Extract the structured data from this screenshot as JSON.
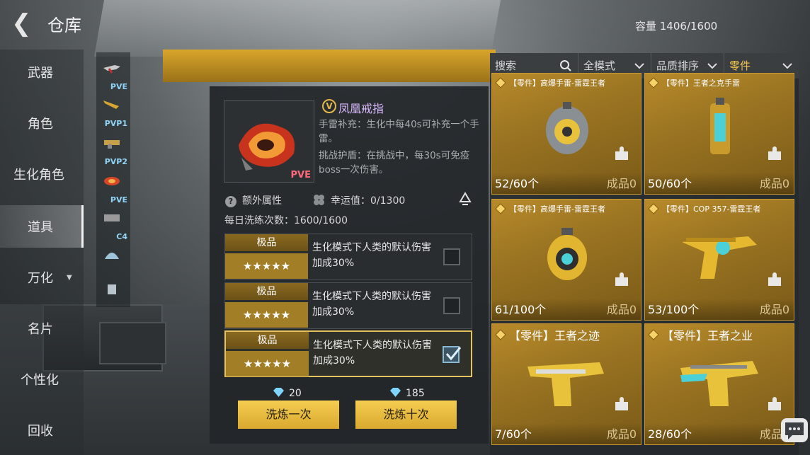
{
  "header": {
    "title": "仓库",
    "capacity": "容量 1406/1600"
  },
  "sidebar": {
    "items": [
      {
        "label": "武器"
      },
      {
        "label": "角色"
      },
      {
        "label": "生化角色"
      },
      {
        "label": "道具"
      },
      {
        "label": "万化"
      },
      {
        "label": "名片"
      },
      {
        "label": "个性化"
      },
      {
        "label": "回收"
      }
    ],
    "active": "道具"
  },
  "categories": [
    {
      "tag": "PVE"
    },
    {
      "tag": "PVP1"
    },
    {
      "tag": "PVP2"
    },
    {
      "tag": "PVE"
    },
    {
      "tag": "C4"
    },
    {
      "tag": ""
    },
    {
      "tag": ""
    }
  ],
  "detail": {
    "badge": "V",
    "name": "凤凰戒指",
    "thumb_tag": "PVE",
    "desc1": "手雷补充：生化中每40s可补充一个手雷。",
    "desc2": "挑战护盾：在挑战中，每30s可免疫boss一次伤害。",
    "extra_label": "额外属性",
    "luck": "幸运值：0/1300",
    "daily": "每日洗练次数：1600/1600",
    "attributes": [
      {
        "grade": "极品",
        "stars": "★★★★★",
        "text": "生化模式下人类的默认伤害加成30%",
        "checked": false
      },
      {
        "grade": "极品",
        "stars": "★★★★★",
        "text": "生化模式下人类的默认伤害加成30%",
        "checked": false
      },
      {
        "grade": "极品",
        "stars": "★★★★★",
        "text": "生化模式下人类的默认伤害加成30%",
        "checked": true
      }
    ],
    "cost_once": "20",
    "cost_ten": "185",
    "btn_once": "洗炼一次",
    "btn_ten": "洗炼十次"
  },
  "filters": {
    "search_placeholder": "搜索",
    "mode": "全模式",
    "sort": "品质排序",
    "type": "零件"
  },
  "cards": [
    {
      "title": "【零件】高爆手雷-雷霆王者",
      "count": "52/60个",
      "made": "成品0"
    },
    {
      "title": "【零件】王者之克手雷",
      "count": "50/60个",
      "made": "成品0"
    },
    {
      "title": "【零件】高爆手雷-雷霆王者",
      "count": "61/100个",
      "made": "成品0"
    },
    {
      "title": "【零件】COP 357-雷霆王者",
      "count": "53/100个",
      "made": "成品0"
    },
    {
      "title": "【零件】王者之迹",
      "count": "7/60个",
      "made": "成品0"
    },
    {
      "title": "【零件】王者之业",
      "count": "28/60个",
      "made": "成品0"
    }
  ],
  "colors": {
    "accent": "#f0c24c",
    "card": "#9a7422",
    "button": "#e5b53c",
    "rarity_purple": "#d9b9ff"
  }
}
